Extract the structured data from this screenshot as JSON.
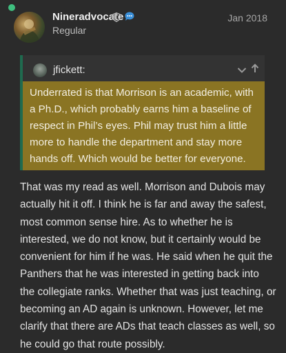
{
  "post": {
    "username": "Nineradvocate",
    "user_title": "Regular",
    "date": "Jan 2018",
    "icons": {
      "shield": "shield-icon",
      "chat": "chat-bubble-icon",
      "online": "online-status-dot"
    },
    "quote": {
      "author": "jfickett:",
      "text": "Underrated is that Morrison is an academic, with a Ph.D., which probably earns him a baseline of respect in Phil’s eyes. Phil may trust him a little more to handle the department and stay more hands off. Which would be better for everyone.",
      "colors": {
        "background": "#8a7423",
        "border": "#1f6b4f"
      }
    },
    "body": "That was my read as well. Morrison and Dubois may actually hit it off. I think he is far and away the safest, most common sense hire. As to whether he is interested, we do not know, but it certainly would be convenient for him if he was. He said when he quit the Panthers that he was interested in getting back into the collegiate ranks. Whether that was just teaching, or becoming an AD again is unknown. However, let me clarify that there are ADs that teach classes as well, so he could go that route possibly."
  }
}
